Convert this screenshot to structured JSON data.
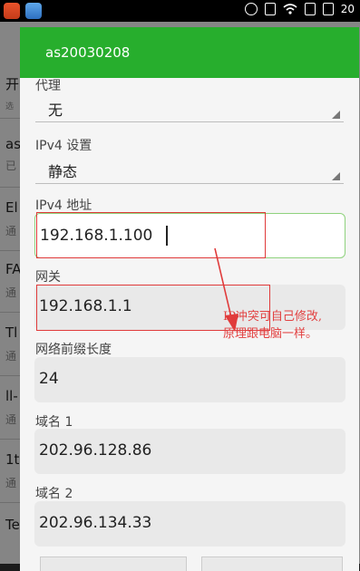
{
  "status_bar": {
    "time": "20"
  },
  "background_list": {
    "items": [
      {
        "title": "开",
        "subtitle": "选"
      },
      {
        "title": "as",
        "subtitle": "已"
      },
      {
        "title": "El",
        "subtitle": "通"
      },
      {
        "title": "FA",
        "subtitle": "通"
      },
      {
        "title": "Tl",
        "subtitle": "通"
      },
      {
        "title": "ll-",
        "subtitle": "通"
      },
      {
        "title": "1t",
        "subtitle": "通"
      },
      {
        "title": "Te",
        "subtitle": ""
      }
    ]
  },
  "dialog": {
    "title": "as20030208",
    "proxy": {
      "label": "代理",
      "value": "无"
    },
    "ipv4_settings": {
      "label": "IPv4 设置",
      "value": "静态"
    },
    "ipv4_address": {
      "label": "IPv4 地址",
      "value": "192.168.1.100"
    },
    "gateway": {
      "label": "网关",
      "value": "192.168.1.1"
    },
    "prefix_length": {
      "label": "网络前缀长度",
      "value": "24"
    },
    "dns1": {
      "label": "域名 1",
      "value": "202.96.128.86"
    },
    "dns2": {
      "label": "域名 2",
      "value": "202.96.134.33"
    }
  },
  "annotation": {
    "line1": "IP冲突可自己修改,",
    "line2": "原理跟电脑一样。",
    "color": "#e24141"
  },
  "colors": {
    "header": "#27ae2d",
    "focus_border": "#8fd27d"
  }
}
